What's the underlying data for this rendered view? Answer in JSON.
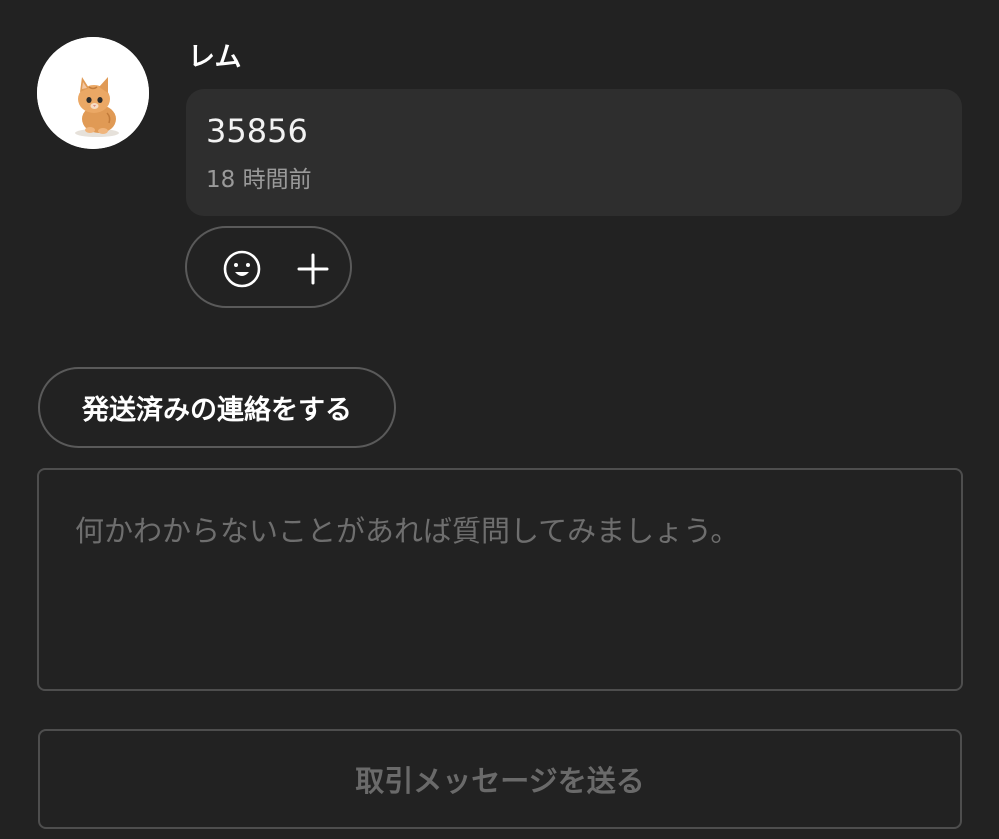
{
  "message": {
    "sender_name": "レム",
    "text": "35856",
    "time": "18 時間前",
    "avatar_icon": "kitten-avatar"
  },
  "reactions": {
    "emoji_icon": "smiley-icon",
    "add_icon": "plus-icon"
  },
  "actions": {
    "notify_shipped_label": "発送済みの連絡をする"
  },
  "composer": {
    "placeholder": "何かわからないことがあれば質問してみましょう。",
    "value": ""
  },
  "send": {
    "label": "取引メッセージを送る",
    "disabled": true
  },
  "colors": {
    "background": "#222222",
    "bubble": "#2e2e2e",
    "border": "#5a5a5a",
    "muted_text": "#9a9a9a",
    "placeholder": "#6e6e6e",
    "disabled_text": "#6a6a6a"
  }
}
